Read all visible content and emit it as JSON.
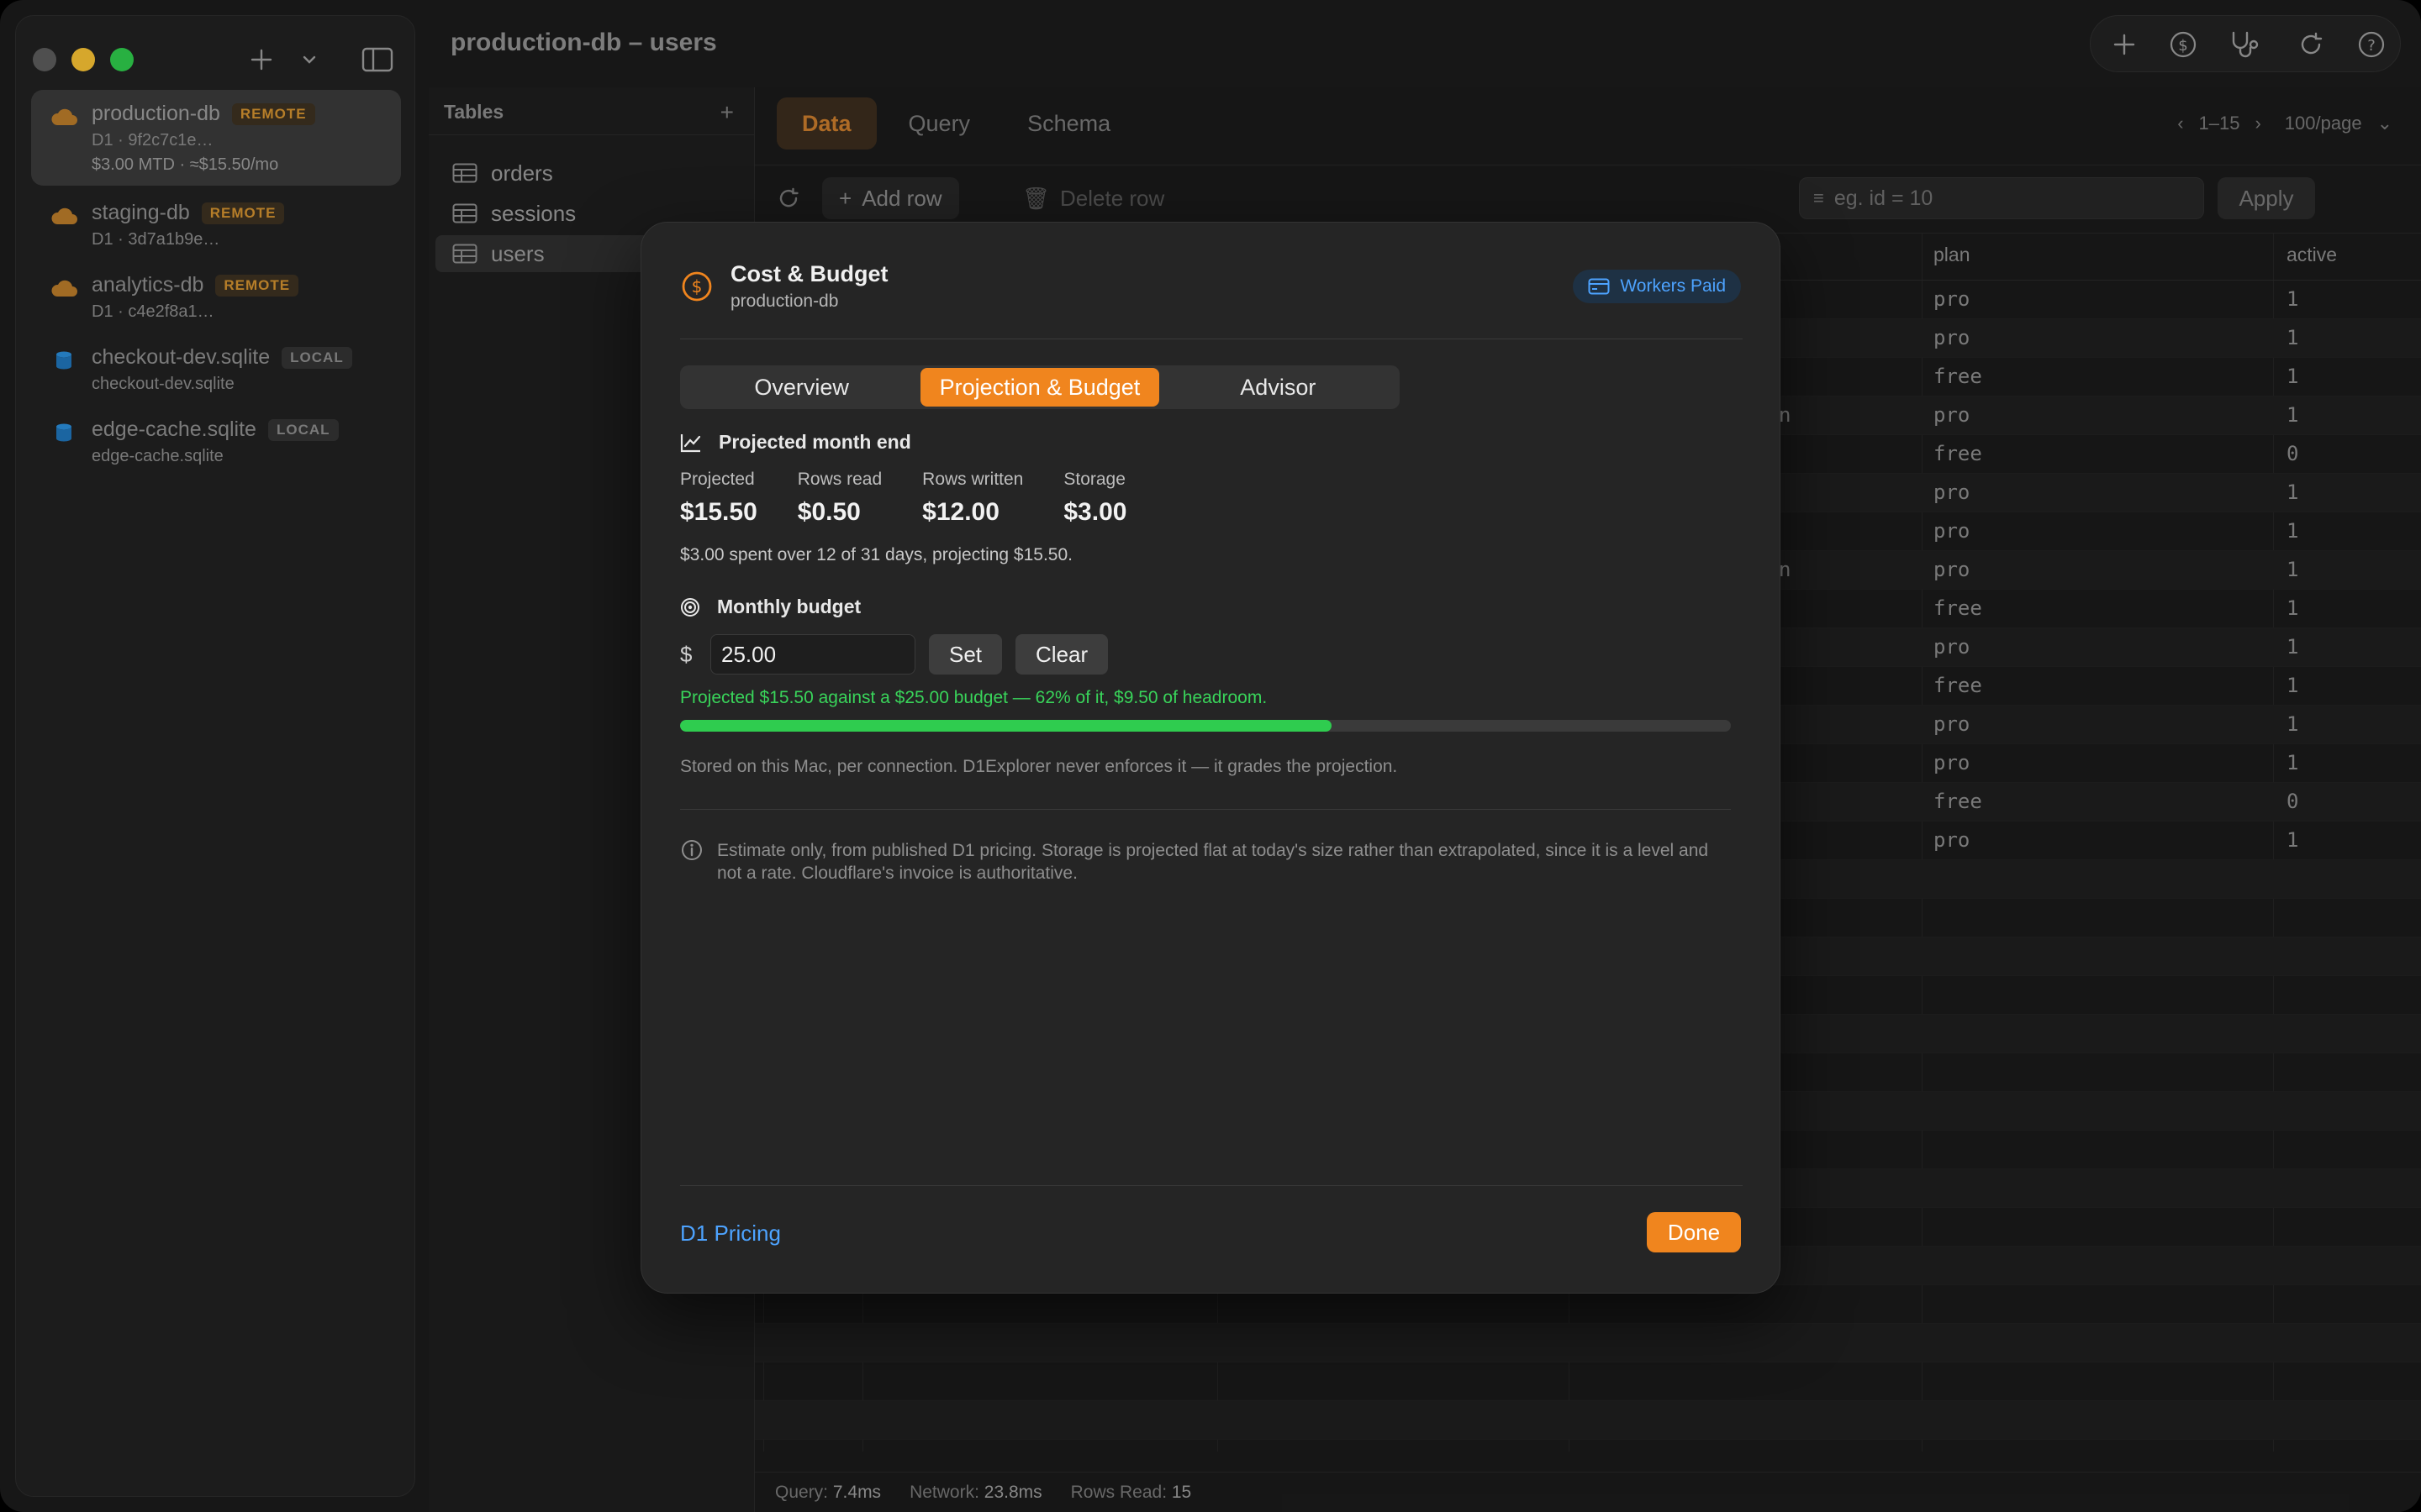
{
  "window": {
    "title": "production-db – users"
  },
  "sidebar": {
    "connections": [
      {
        "name": "production-db",
        "badge": "REMOTE",
        "sub": "D1 · 9f2c7c1e…",
        "cost": "$3.00 MTD · ≈$15.50/mo",
        "icon": "cloud-icon",
        "active": true
      },
      {
        "name": "staging-db",
        "badge": "REMOTE",
        "sub": "D1 · 3d7a1b9e…",
        "icon": "cloud-icon"
      },
      {
        "name": "analytics-db",
        "badge": "REMOTE",
        "sub": "D1 · c4e2f8a1…",
        "icon": "cloud-icon"
      },
      {
        "name": "checkout-dev.sqlite",
        "badge": "LOCAL",
        "sub": "checkout-dev.sqlite",
        "icon": "database-icon"
      },
      {
        "name": "edge-cache.sqlite",
        "badge": "LOCAL",
        "sub": "edge-cache.sqlite",
        "icon": "database-icon"
      }
    ]
  },
  "tables": {
    "header": "Tables",
    "items": [
      "orders",
      "sessions",
      "users"
    ],
    "selected": "users"
  },
  "main": {
    "tabs": [
      "Data",
      "Query",
      "Schema"
    ],
    "active_tab": "Data",
    "pager": {
      "range": "1–15",
      "per_page": "100/page"
    },
    "actions": {
      "add_row": "Add row",
      "delete_row": "Delete row",
      "apply": "Apply"
    },
    "filter": {
      "placeholder": "eg. id = 10"
    },
    "columns": {
      "plan": "plan",
      "active": "active"
    },
    "rows": [
      {
        "mid": "",
        "plan": "pro",
        "active": "1"
      },
      {
        "mid": "",
        "plan": "pro",
        "active": "1"
      },
      {
        "mid": "",
        "plan": "free",
        "active": "1"
      },
      {
        "mid": "n",
        "plan": "pro",
        "active": "1"
      },
      {
        "mid": "",
        "plan": "free",
        "active": "0"
      },
      {
        "mid": "",
        "plan": "pro",
        "active": "1"
      },
      {
        "mid": "",
        "plan": "pro",
        "active": "1"
      },
      {
        "mid": "n",
        "plan": "pro",
        "active": "1"
      },
      {
        "mid": "",
        "plan": "free",
        "active": "1"
      },
      {
        "mid": "",
        "plan": "pro",
        "active": "1"
      },
      {
        "mid": "",
        "plan": "free",
        "active": "1"
      },
      {
        "mid": "",
        "plan": "pro",
        "active": "1"
      },
      {
        "mid": "",
        "plan": "pro",
        "active": "1"
      },
      {
        "mid": "",
        "plan": "free",
        "active": "0"
      },
      {
        "mid": "",
        "plan": "pro",
        "active": "1"
      }
    ],
    "status": {
      "query_label": "Query:",
      "query": "7.4ms",
      "network_label": "Network:",
      "network": "23.8ms",
      "rows_label": "Rows Read:",
      "rows": "15"
    }
  },
  "modal": {
    "title": "Cost & Budget",
    "subtitle": "production-db",
    "plan_badge": "Workers Paid",
    "segments": [
      "Overview",
      "Projection & Budget",
      "Advisor"
    ],
    "active_segment": "Projection & Budget",
    "projection": {
      "heading": "Projected month end",
      "metrics": [
        {
          "label": "Projected",
          "value": "$15.50"
        },
        {
          "label": "Rows read",
          "value": "$0.50"
        },
        {
          "label": "Rows written",
          "value": "$12.00"
        },
        {
          "label": "Storage",
          "value": "$3.00"
        }
      ],
      "note": "$3.00 spent over 12 of 31 days, projecting $15.50."
    },
    "budget": {
      "heading": "Monthly budget",
      "currency": "$",
      "value": "25.00",
      "set_label": "Set",
      "clear_label": "Clear",
      "status": "Projected $15.50 against a $25.00 budget — 62% of it, $9.50 of headroom.",
      "progress_percent": 62,
      "storage_note": "Stored on this Mac, per connection. D1Explorer never enforces it — it grades the projection."
    },
    "info": "Estimate only, from published D1 pricing. Storage is projected flat at today's size rather than extrapolated, since it is a level and not a rate. Cloudflare's invoice is authoritative.",
    "footer_link": "D1 Pricing",
    "done_label": "Done"
  },
  "colors": {
    "accent": "#f0851e",
    "success": "#2fcc4f",
    "link": "#4da3ff",
    "remote_badge": "#d0902f"
  }
}
